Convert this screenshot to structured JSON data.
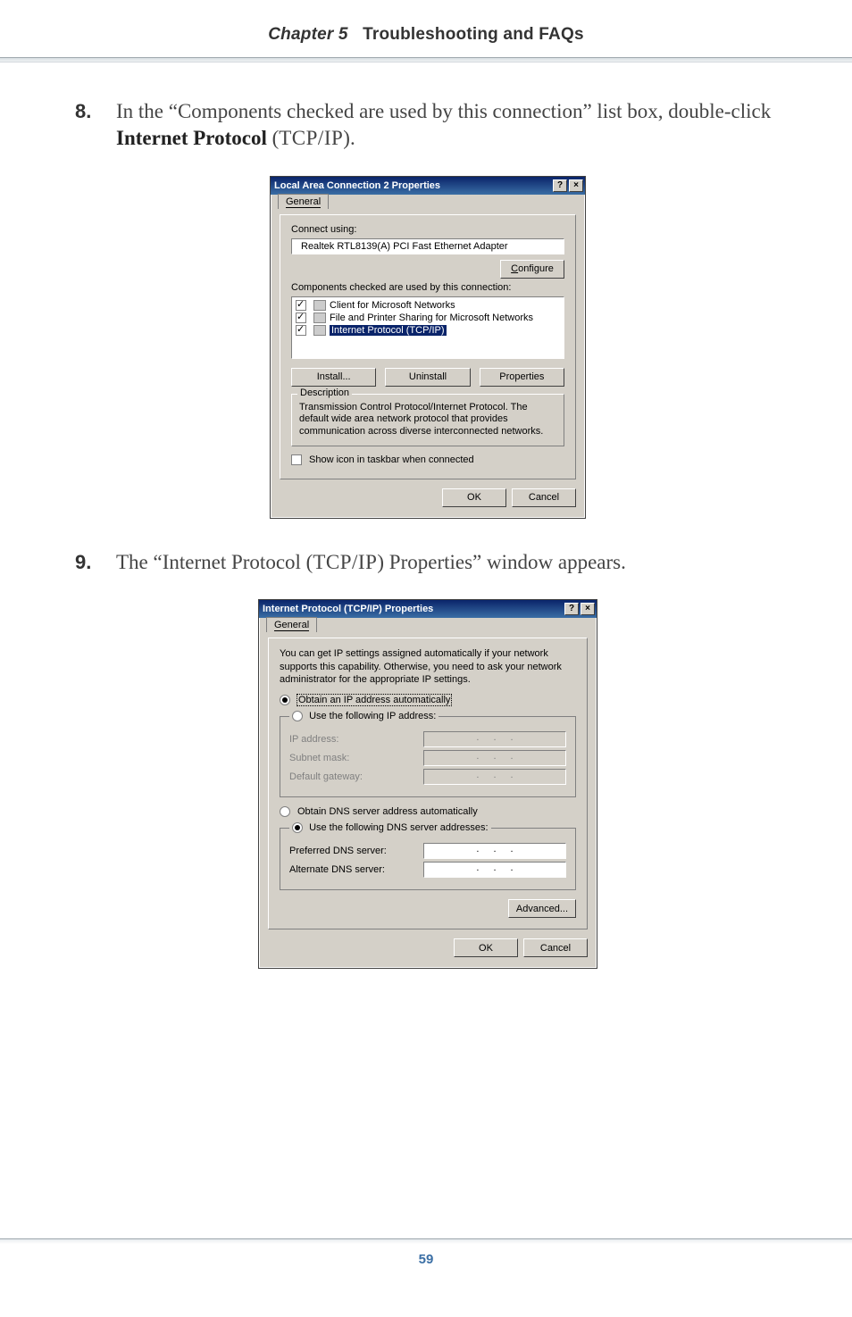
{
  "header": {
    "chapter": "Chapter 5",
    "title": "Troubleshooting and FAQs"
  },
  "step8": {
    "num": "8.",
    "pre": "In the “Components checked are used by this connection” list box, double-click ",
    "bold": "Internet Protocol",
    "post": " (",
    "sc": "TCP/IP",
    "close": ")."
  },
  "step9": {
    "num": "9.",
    "text_a": "The “Internet Protocol (",
    "sc": "TCP/IP",
    "text_b": ") Properties” window appears."
  },
  "dlg1": {
    "title": "Local Area Connection 2 Properties",
    "tab": "General",
    "connect_using": "Connect using:",
    "adapter": "Realtek RTL8139(A) PCI Fast Ethernet Adapter",
    "configure": "Configure",
    "components_label": "Components checked are used by this connection:",
    "items": [
      "Client for Microsoft Networks",
      "File and Printer Sharing for Microsoft Networks",
      "Internet Protocol (TCP/IP)"
    ],
    "install": "Install...",
    "uninstall": "Uninstall",
    "properties": "Properties",
    "desc_h": "Description",
    "desc": "Transmission Control Protocol/Internet Protocol. The default wide area network protocol that provides communication across diverse interconnected networks.",
    "showicon": "Show icon in taskbar when connected",
    "ok": "OK",
    "cancel": "Cancel"
  },
  "dlg2": {
    "title": "Internet Protocol (TCP/IP) Properties",
    "tab": "General",
    "blurb": "You can get IP settings assigned automatically if your network supports this capability. Otherwise, you need to ask your network administrator for the appropriate IP settings.",
    "r1": "Obtain an IP address automatically",
    "r2": "Use the following IP address:",
    "ip_label": "IP address:",
    "subnet_label": "Subnet mask:",
    "gw_label": "Default gateway:",
    "r3": "Obtain DNS server address automatically",
    "r4": "Use the following DNS server addresses:",
    "pdns": "Preferred DNS server:",
    "adns": "Alternate DNS server:",
    "advanced": "Advanced...",
    "ok": "OK",
    "cancel": "Cancel"
  },
  "page": "59"
}
